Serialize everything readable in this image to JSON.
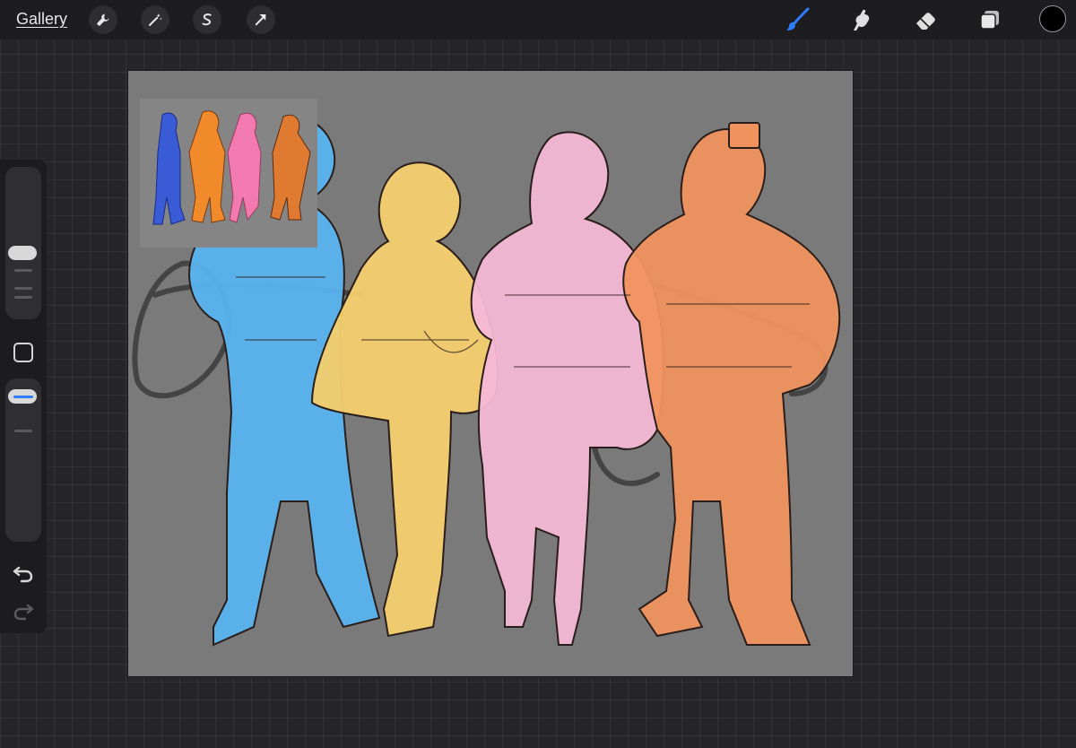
{
  "toolbar": {
    "gallery_label": "Gallery",
    "left_tools": [
      {
        "name": "actions",
        "icon": "wrench-icon"
      },
      {
        "name": "adjustments",
        "icon": "magic-wand-icon"
      },
      {
        "name": "selection",
        "icon": "selection-s-icon"
      },
      {
        "name": "transform",
        "icon": "arrow-cursor-icon"
      }
    ],
    "right_tools": [
      {
        "name": "brush",
        "icon": "brush-icon",
        "active": true
      },
      {
        "name": "smudge",
        "icon": "smudge-finger-icon"
      },
      {
        "name": "eraser",
        "icon": "eraser-icon"
      },
      {
        "name": "layers",
        "icon": "layers-icon"
      }
    ],
    "current_color": "#000000",
    "active_color": "#2f7dff"
  },
  "sidebar": {
    "brush_size_level": 0.15,
    "opacity_level": 0.12,
    "buttons": [
      "modify-square-icon",
      "undo-icon",
      "redo-icon"
    ]
  },
  "canvas": {
    "background": "#7a7a7a",
    "figure_colors": [
      "#58b3ee",
      "#f5cf6e",
      "#f4b8d6",
      "#f0935e"
    ],
    "watermark_text_color": "#3a3a3a"
  }
}
